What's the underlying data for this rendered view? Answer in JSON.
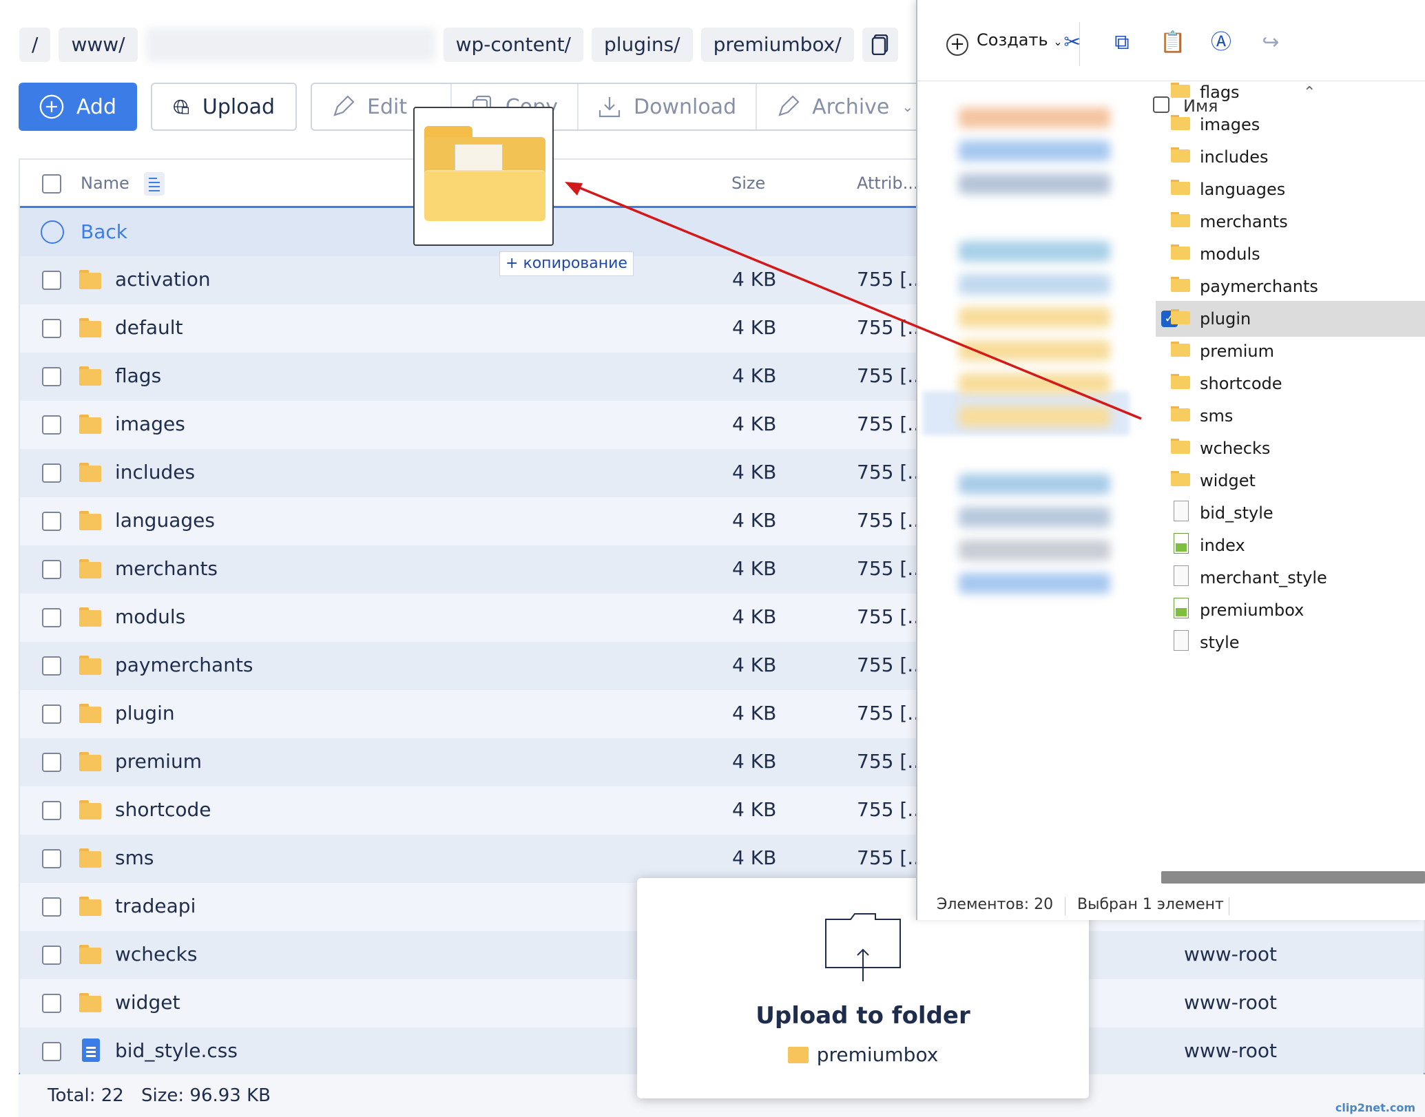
{
  "breadcrumbs": [
    "/",
    "www/",
    "",
    "wp-content/",
    "plugins/",
    "premiumbox/"
  ],
  "toolbar": {
    "add": "Add",
    "upload": "Upload",
    "edit": "Edit",
    "copy": "Copy",
    "download": "Download",
    "archive": "Archive"
  },
  "table": {
    "col_name": "Name",
    "col_size": "Size",
    "col_attr": "Attrib...",
    "back": "Back",
    "rows": [
      {
        "name": "activation",
        "size": "4 KB",
        "attr": "755 [...",
        "owner": ""
      },
      {
        "name": "default",
        "size": "4 KB",
        "attr": "755 [...",
        "owner": ""
      },
      {
        "name": "flags",
        "size": "4 KB",
        "attr": "755 [...",
        "owner": ""
      },
      {
        "name": "images",
        "size": "4 KB",
        "attr": "755 [...",
        "owner": ""
      },
      {
        "name": "includes",
        "size": "4 KB",
        "attr": "755 [...",
        "owner": ""
      },
      {
        "name": "languages",
        "size": "4 KB",
        "attr": "755 [...",
        "owner": ""
      },
      {
        "name": "merchants",
        "size": "4 KB",
        "attr": "755 [...",
        "owner": ""
      },
      {
        "name": "moduls",
        "size": "4 KB",
        "attr": "755 [...",
        "owner": ""
      },
      {
        "name": "paymerchants",
        "size": "4 KB",
        "attr": "755 [...",
        "owner": ""
      },
      {
        "name": "plugin",
        "size": "4 KB",
        "attr": "755 [...",
        "owner": ""
      },
      {
        "name": "premium",
        "size": "4 KB",
        "attr": "755 [...",
        "owner": ""
      },
      {
        "name": "shortcode",
        "size": "4 KB",
        "attr": "755 [...",
        "owner": ""
      },
      {
        "name": "sms",
        "size": "4 KB",
        "attr": "755 [...",
        "owner": ""
      },
      {
        "name": "tradeapi",
        "size": "",
        "attr": "",
        "owner": ""
      },
      {
        "name": "wchecks",
        "size": "",
        "attr": "",
        "owner": "www-root"
      },
      {
        "name": "widget",
        "size": "",
        "attr": "",
        "owner": "www-root"
      },
      {
        "name": "bid_style.css",
        "size": "",
        "attr": "",
        "owner": "www-root",
        "file": true
      }
    ]
  },
  "footer": {
    "total": "Total: 22",
    "size": "Size: 96.93 KB"
  },
  "drag": {
    "copy_label": "копирование"
  },
  "upload_overlay": {
    "title": "Upload to folder",
    "folder": "premiumbox"
  },
  "explorer": {
    "create": "Создать",
    "col_name": "Имя",
    "items": [
      {
        "name": "flags",
        "type": "folder"
      },
      {
        "name": "images",
        "type": "folder"
      },
      {
        "name": "includes",
        "type": "folder"
      },
      {
        "name": "languages",
        "type": "folder"
      },
      {
        "name": "merchants",
        "type": "folder"
      },
      {
        "name": "moduls",
        "type": "folder"
      },
      {
        "name": "paymerchants",
        "type": "folder"
      },
      {
        "name": "plugin",
        "type": "folder",
        "selected": true
      },
      {
        "name": "premium",
        "type": "folder"
      },
      {
        "name": "shortcode",
        "type": "folder"
      },
      {
        "name": "sms",
        "type": "folder"
      },
      {
        "name": "wchecks",
        "type": "folder"
      },
      {
        "name": "widget",
        "type": "folder"
      },
      {
        "name": "bid_style",
        "type": "file"
      },
      {
        "name": "index",
        "type": "image"
      },
      {
        "name": "merchant_style",
        "type": "file"
      },
      {
        "name": "premiumbox",
        "type": "image"
      },
      {
        "name": "style",
        "type": "file"
      }
    ],
    "status_count": "Элементов: 20",
    "status_selected": "Выбран 1 элемент"
  },
  "watermark": "clip2net.com",
  "colors": {
    "accent": "#3c7ce6",
    "arrow": "#d21a1a",
    "folder": "#f6c45b"
  }
}
